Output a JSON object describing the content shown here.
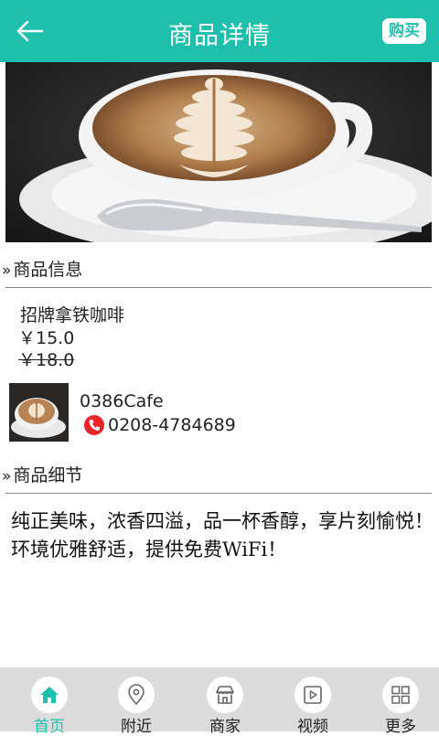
{
  "header": {
    "title": "商品详情",
    "buy_label": "购买"
  },
  "sections": {
    "info_title": "商品信息",
    "detail_title": "商品细节",
    "arrows": "»"
  },
  "product": {
    "name": "招牌拿铁咖啡",
    "price": "￥15.0",
    "original_price": "￥18.0"
  },
  "shop": {
    "name": "0386Cafe",
    "phone": "0208-4784689"
  },
  "details_text": "纯正美味，浓香四溢，品一杯香醇，享片刻愉悦！环境优雅舒适，提供免费WiFi！",
  "tabbar": {
    "items": [
      {
        "label": "首页",
        "icon": "home-icon",
        "active": true
      },
      {
        "label": "附近",
        "icon": "location-pin-icon",
        "active": false
      },
      {
        "label": "商家",
        "icon": "store-icon",
        "active": false
      },
      {
        "label": "视频",
        "icon": "video-icon",
        "active": false
      },
      {
        "label": "更多",
        "icon": "grid-icon",
        "active": false
      }
    ]
  },
  "colors": {
    "accent": "#1fbfae",
    "tabbar_bg": "#dcdcdc",
    "phone_icon": "#e8262a"
  }
}
